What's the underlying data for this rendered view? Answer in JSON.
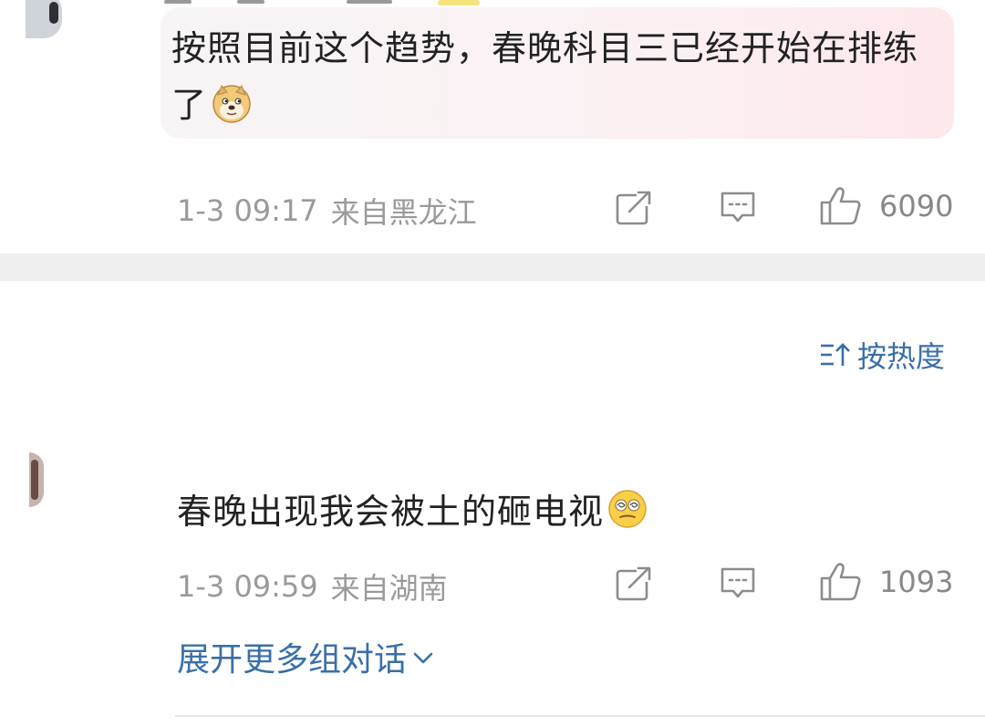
{
  "comments": [
    {
      "text": "按照目前这个趋势，春晚科目三已经开始在排练了",
      "emoji": "doge-emoji",
      "time": "1-3 09:17",
      "location": "来自黑龙江",
      "likes": "6090"
    },
    {
      "text": "春晚出现我会被土的砸电视",
      "emoji": "dizzy-face-emoji",
      "time": "1-3 09:59",
      "location": "来自湖南",
      "likes": "1093"
    }
  ],
  "sort": {
    "label": "按热度",
    "icon": "sort-icon"
  },
  "expand": {
    "label": "展开更多组对话",
    "icon": "chevron-down-icon"
  },
  "icons": {
    "share": "share-icon",
    "comment": "comment-icon",
    "like": "thumbs-up-icon"
  },
  "colors": {
    "link": "#3a6fa8",
    "meta": "#9a9a9a",
    "divider": "#efefef"
  }
}
